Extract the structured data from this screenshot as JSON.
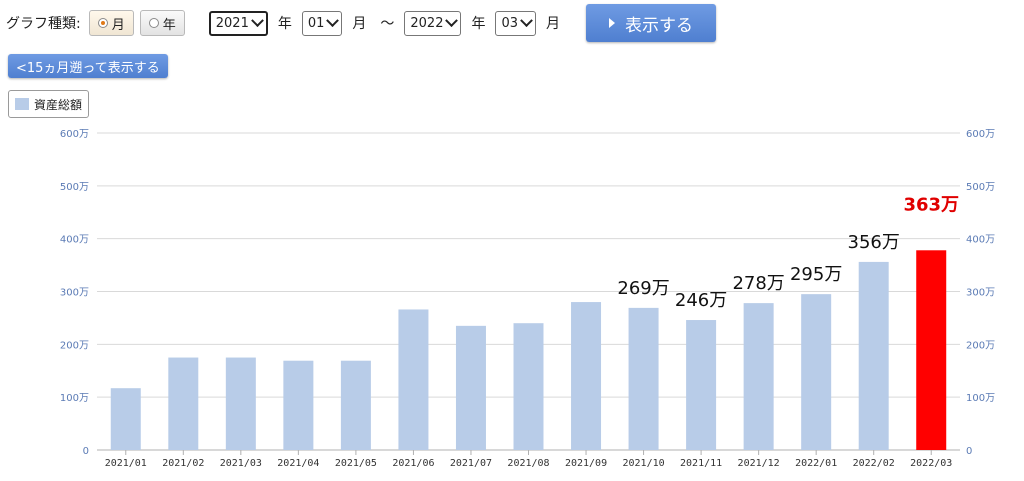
{
  "toolbar": {
    "graph_type_label": "グラフ種類:",
    "radio_month": "月",
    "radio_year": "年",
    "start_year": "2021",
    "start_month": "01",
    "end_year": "2022",
    "end_month": "03",
    "year_unit": "年",
    "month_unit": "月",
    "range_sep": "〜",
    "show_button": "表示する",
    "back_button": "<15ヵ月遡って表示する"
  },
  "colors": {
    "bar": "#b8cce8",
    "highlight": "#ff0000",
    "grid": "#d9d9d9",
    "button": "#5b8bd8"
  },
  "chart_data": {
    "type": "bar",
    "legend": "資産総額",
    "legend_position": "top-left",
    "categories": [
      "2021/01",
      "2021/02",
      "2021/03",
      "2021/04",
      "2021/05",
      "2021/06",
      "2021/07",
      "2021/08",
      "2021/09",
      "2021/10",
      "2021/11",
      "2021/12",
      "2022/01",
      "2022/02",
      "2022/03"
    ],
    "values": [
      117,
      175,
      175,
      169,
      169,
      266,
      235,
      240,
      280,
      269,
      246,
      278,
      295,
      356,
      378
    ],
    "data_labels": [
      "",
      "",
      "",
      "",
      "",
      "",
      "",
      "",
      "",
      "269万",
      "246万",
      "278万",
      "295万",
      "356万",
      "363万"
    ],
    "highlight_index": 14,
    "y_ticks": [
      "0",
      "100万",
      "200万",
      "300万",
      "400万",
      "500万",
      "600万"
    ],
    "ylim": [
      0,
      600
    ],
    "grid": true,
    "dual_y_axis": true
  }
}
